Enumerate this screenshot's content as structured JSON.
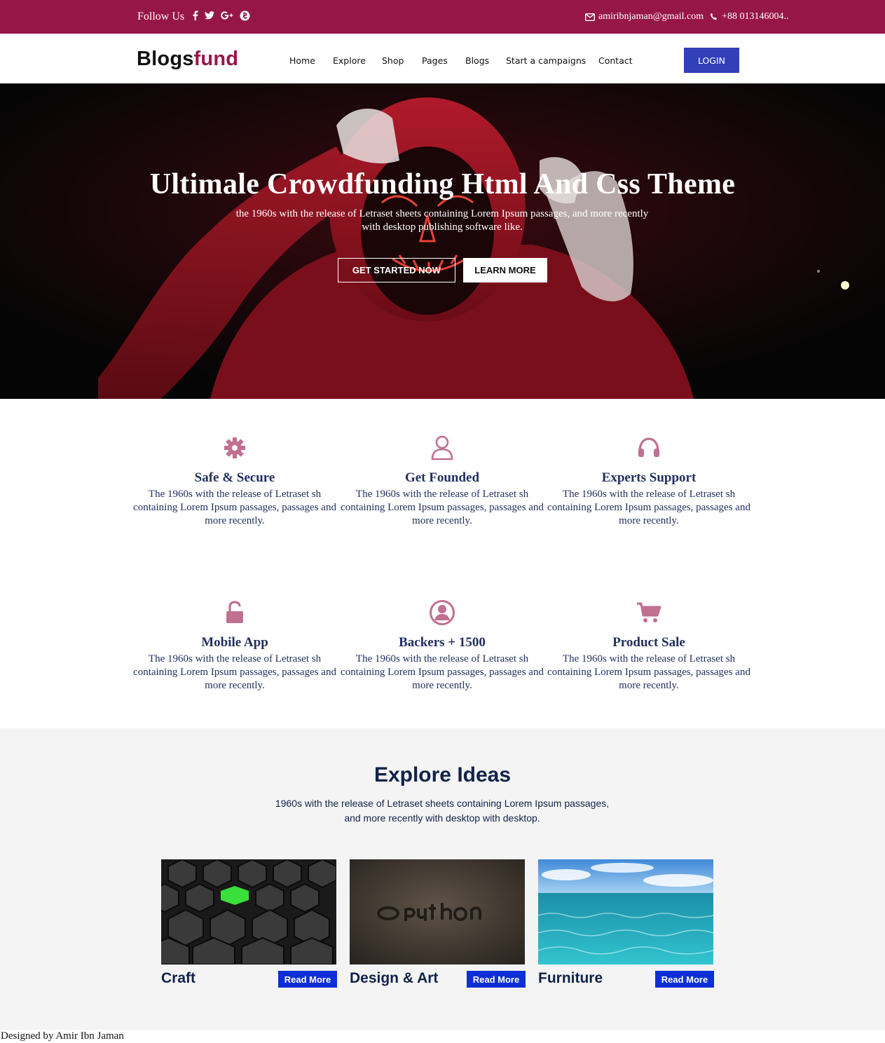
{
  "topbar": {
    "follow_label": "Follow Us",
    "social_icons": [
      "facebook-icon",
      "twitter-icon",
      "google-plus-icon",
      "firefox-icon"
    ],
    "email": "amiribnjaman@gmail.com",
    "phone": "+88 013146004..",
    "bg_color": "#961747"
  },
  "nav": {
    "brand_part1": "Blogs",
    "brand_part2": "fund",
    "items": [
      "Home",
      "Explore",
      "Shop",
      "Pages",
      "Blogs",
      "Start a campaigns",
      "Contact"
    ],
    "login_label": "LOGIN",
    "login_color": "#3140b8"
  },
  "hero": {
    "title": "Ultimale Crowdfunding Html And Css Theme",
    "subtitle": "the 1960s with the release of Letraset sheets containing Lorem Ipsum passages, and more recently with desktop publishing software like.",
    "primary_button": "GET STARTED NOW",
    "secondary_button": "LEARN MORE"
  },
  "features": [
    {
      "icon": "gear-icon",
      "title": "Safe & Secure",
      "text": "The 1960s with the release of Letraset sh containing Lorem Ipsum passages, passages and more recently."
    },
    {
      "icon": "user-icon",
      "title": "Get Founded",
      "text": "The 1960s with the release of Letraset sh containing Lorem Ipsum passages, passages and more recently."
    },
    {
      "icon": "headphones-icon",
      "title": "Experts Support",
      "text": "The 1960s with the release of Letraset sh containing Lorem Ipsum passages, passages and more recently."
    },
    {
      "icon": "unlock-icon",
      "title": "Mobile App",
      "text": "The 1960s with the release of Letraset sh containing Lorem Ipsum passages, passages and more recently."
    },
    {
      "icon": "user-circle-icon",
      "title": "Backers + 1500",
      "text": "The 1960s with the release of Letraset sh containing Lorem Ipsum passages, passages and more recently."
    },
    {
      "icon": "cart-icon",
      "title": "Product Sale",
      "text": "The 1960s with the release of Letraset sh containing Lorem Ipsum passages, passages and more recently."
    }
  ],
  "feature_icon_color": "#c07090",
  "explore": {
    "title": "Explore Ideas",
    "lead": "1960s with the release of Letraset sheets containing Lorem Ipsum passages, and more recently with desktop with desktop.",
    "cards": [
      {
        "title": "Craft",
        "button": "Read More"
      },
      {
        "title": "Design & Art",
        "button": "Read More"
      },
      {
        "title": "Furniture",
        "button": "Read More"
      }
    ]
  },
  "footer": {
    "credit": "Designed by Amir Ibn Jaman"
  }
}
